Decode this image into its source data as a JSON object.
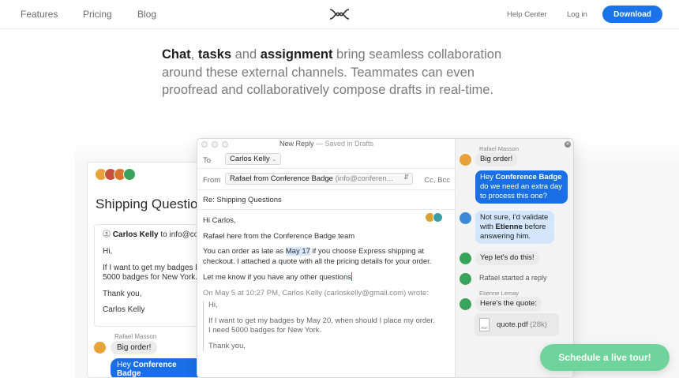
{
  "nav": {
    "features": "Features",
    "pricing": "Pricing",
    "blog": "Blog",
    "help_center": "Help Center",
    "login": "Log in",
    "download": "Download"
  },
  "headline": {
    "w1": "Chat",
    "w2": ", ",
    "w3": "tasks",
    "w4": " and ",
    "w5": "assignment",
    "w6": " bring seamless collaboration around these external channels. Teammates can even proofread and collaboratively compose drafts in real-time."
  },
  "bg_window": {
    "subject": "Shipping Questions",
    "from_name": "Carlos Kelly",
    "from_rest": " to info@co",
    "lines": [
      "Hi,",
      "If I want to get my badges b",
      "5000 badges for New York.",
      "Thank you,",
      "Carlos Kelly"
    ],
    "chat_name": "Rafael Masson",
    "chat_msg1": "Big order!",
    "chat_msg2_pre": "Hey ",
    "chat_msg2_bold": "Conference Badge"
  },
  "compose": {
    "title": "New Reply",
    "saved": " — Saved in Drafts",
    "to_label": "To",
    "to_value": "Carlos Kelly",
    "from_label": "From",
    "from_value": "Rafael from Conference Badge",
    "from_sub": "(info@conferen...",
    "cc_bcc": "Cc, Bcc",
    "subject": "Re: Shipping Questions",
    "greeting": "Hi Carlos,",
    "line1": "Rafael here from the Conference Badge team",
    "line2_pre": "You can order as late as ",
    "line2_hl": "May 17",
    "line2_post": " if you choose Express shipping at",
    "line3": "checkout. I attached a quote with all the pricing details for your order.",
    "line4": "Let me know if you have any other questions",
    "quote_header": "On May 5 at 10:27 PM, Carlos Kelly (carloskelly@gmail.com) wrote:",
    "quote_lines": [
      "Hi,",
      "If I want to get my badges by May 20, when should I place my order.",
      "I need 5000 badges for New York.",
      "Thank you,"
    ]
  },
  "chat": {
    "m1_name": "Rafael Masson",
    "m1_text": "Big order!",
    "m2_pre": "Hey ",
    "m2_bold": "Conference Badge",
    "m2_post": " do we need an extra day to process this one?",
    "m3_pre": "Not sure, I'd validate with ",
    "m3_bold": "Etienne",
    "m3_post": " before answering him.",
    "m4_text": "Yep let's do this!",
    "m5_sys": "Rafael started a reply",
    "m6_name": "Etienne Lemay",
    "m6_text": "Here's the quote:",
    "file_name": "quote.pdf",
    "file_size": " (28k)",
    "file_icon_label": "PDF"
  },
  "cta": "Schedule a live tour!",
  "colors": {
    "accent": "#1a73e8",
    "cta": "#6fd49b",
    "bubble_blue": "#1a6fe6",
    "bubble_light_blue": "#d4e6fb"
  }
}
